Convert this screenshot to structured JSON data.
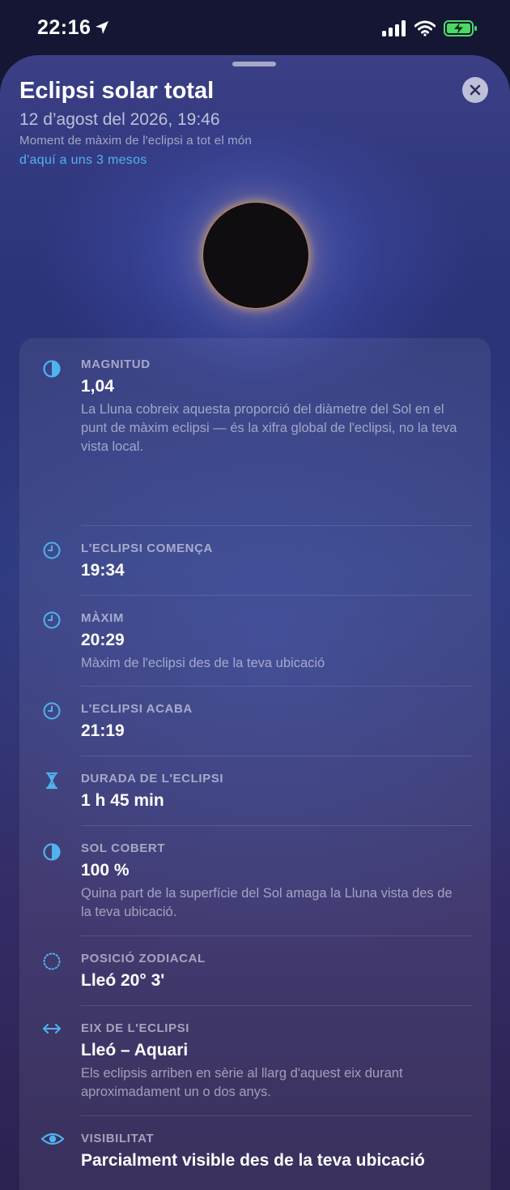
{
  "status_bar": {
    "time": "22:16",
    "icons": [
      "location-arrow-icon",
      "cellular-signal-icon",
      "wifi-icon",
      "battery-charging-icon"
    ]
  },
  "sheet": {
    "title": "Eclipsi solar total",
    "datetime": "12 d’agost del 2026, 19:46",
    "description": "Moment de màxim de l'eclipsi a tot el món",
    "relative": "d'aquí a uns 3 mesos",
    "accent_color": "#4fb3ef"
  },
  "details": [
    {
      "icon": "half-circle-icon",
      "label": "MAGNITUD",
      "value": "1,04",
      "note": "La Lluna cobreix aquesta proporció del diàmetre del Sol en el punt de màxim eclipsi — és la xifra global de l'eclipsi, no la teva vista local."
    },
    {
      "icon": "clock-icon",
      "label": "L'ECLIPSI COMENÇA",
      "value": "19:34"
    },
    {
      "icon": "clock-icon",
      "label": "MÀXIM",
      "value": "20:29",
      "note": "Màxim de l'eclipsi des de la teva ubicació"
    },
    {
      "icon": "clock-icon",
      "label": "L'ECLIPSI ACABA",
      "value": "21:19"
    },
    {
      "icon": "hourglass-icon",
      "label": "DURADA DE L'ECLIPSI",
      "value": "1 h 45 min"
    },
    {
      "icon": "half-circle-icon",
      "label": "SOL COBERT",
      "value": "100 %",
      "note": "Quina part de la superfície del Sol amaga la Lluna vista des de la teva ubicació."
    },
    {
      "icon": "dotted-circle-icon",
      "label": "POSICIÓ ZODIACAL",
      "value": "Lleó 20° 3'"
    },
    {
      "icon": "axis-arrows-icon",
      "label": "EIX DE L'ECLIPSI",
      "value": "Lleó – Aquari",
      "note": "Els eclipsis arriben en sèrie al llarg d'aquest eix durant aproximadament un o dos anys."
    },
    {
      "icon": "eye-icon",
      "label": "VISIBILITAT",
      "value": "Parcialment visible des de la teva ubicació"
    }
  ]
}
